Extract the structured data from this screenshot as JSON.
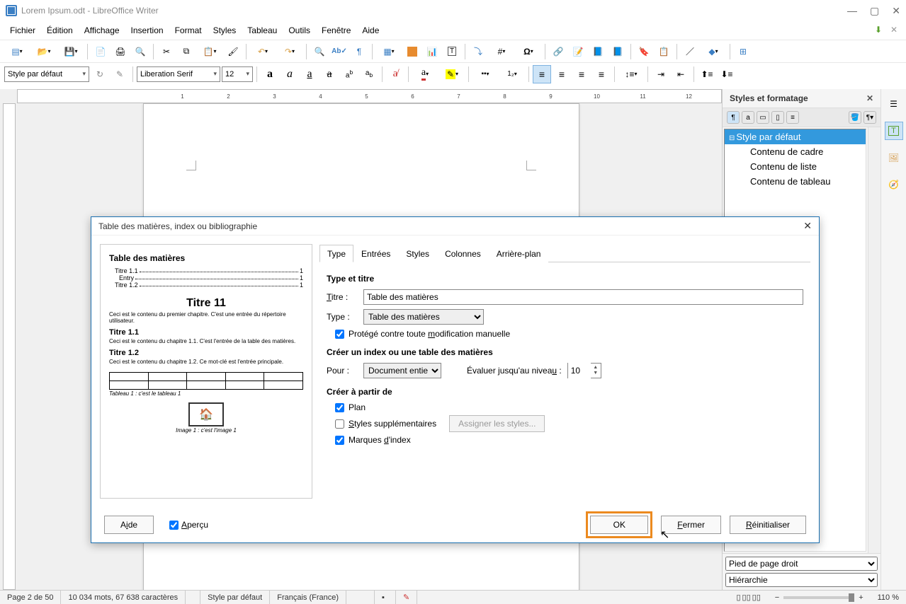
{
  "window": {
    "title": "Lorem Ipsum.odt - LibreOffice Writer"
  },
  "menu": [
    "Fichier",
    "Édition",
    "Affichage",
    "Insertion",
    "Format",
    "Styles",
    "Tableau",
    "Outils",
    "Fenêtre",
    "Aide"
  ],
  "toolbar2": {
    "style_combo": "Style par défaut",
    "font_combo": "Liberation Serif",
    "size_combo": "12"
  },
  "sidebar": {
    "title": "Styles et formatage",
    "items": [
      "Style par défaut",
      "Contenu de cadre",
      "Contenu de liste",
      "Contenu de tableau"
    ],
    "footer_select1": "Pied de page droit",
    "footer_select2": "Hiérarchie"
  },
  "ruler_ticks": [
    "1",
    "2",
    "3",
    "4",
    "5",
    "6",
    "7",
    "8",
    "9",
    "10",
    "11",
    "12"
  ],
  "dialog": {
    "title": "Table des matières, index ou bibliographie",
    "tabs": [
      "Type",
      "Entrées",
      "Styles",
      "Colonnes",
      "Arrière-plan"
    ],
    "preview": {
      "h": "Table des matières",
      "toc": [
        {
          "label": "Titre 1.1",
          "page": "1"
        },
        {
          "label": "Entry",
          "page": "1"
        },
        {
          "label": "Titre 1.2",
          "page": "1"
        }
      ],
      "big_title": "Titre 11",
      "body1": "Ceci est le contenu du premier chapitre. C'est une entrée du répertoire utilisateur.",
      "sub1": "Titre 1.1",
      "body2": "Ceci est le contenu du chapitre 1.1. C'est l'entrée de la table des matières.",
      "sub2": "Titre 1.2",
      "body3": "Ceci est le contenu du chapitre 1.2. Ce mot-clé est l'entrée principale.",
      "table_cap": "Tableau 1 : c'est le tableau 1",
      "img_cap": "Image 1 : c'est l'image 1"
    },
    "form": {
      "sec1": "Type et titre",
      "titre_label": "Titre :",
      "titre_value": "Table des matières",
      "type_label": "Type :",
      "type_value": "Table des matières",
      "protect": "Protégé contre toute modification manuelle",
      "sec2": "Créer un index ou une table des matières",
      "pour_label": "Pour :",
      "pour_value": "Document entier",
      "niveau_label": "Évaluer jusqu'au niveau :",
      "niveau_value": "10",
      "sec3": "Créer à partir de",
      "chk_plan": "Plan",
      "chk_styles": "Styles supplémentaires",
      "assign_btn": "Assigner les styles...",
      "chk_marques": "Marques d'index"
    },
    "footer": {
      "aide": "Aide",
      "apercu": "Aperçu",
      "ok": "OK",
      "fermer": "Fermer",
      "reset": "Réinitialiser"
    }
  },
  "status": {
    "page": "Page 2 de 50",
    "words": "10 034 mots, 67 638 caractères",
    "style": "Style par défaut",
    "lang": "Français (France)",
    "zoom": "110 %"
  }
}
